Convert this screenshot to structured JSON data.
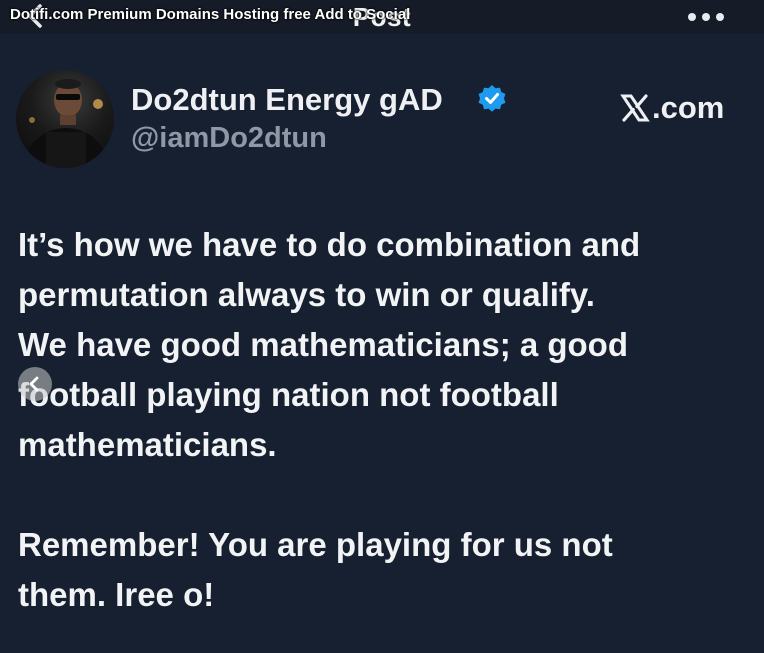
{
  "topbar": {
    "title": "Post",
    "overlay_text": "Dotifi.com Premium Domains Hosting free Add to Social",
    "back_icon": "chevron-left-icon",
    "more_icon": "more-horizontal-icon"
  },
  "tweet": {
    "display_name": "Do2dtun Energy gAD",
    "verified_icon": "verified-badge-icon",
    "verified_color": "#1d9bf0",
    "handle": "@iamDo2dtun",
    "platform": ".com",
    "platform_icon": "x-logo-icon",
    "paragraphs": [
      "It’s how we have to do combination and\npermutation always to win or qualify.\nWe have good mathematicians; a good\nfootball playing nation not football\nmathematicians.",
      "Remember! You are playing for us not\nthem. Iree o!"
    ]
  },
  "carousel": {
    "prev_icon": "chevron-left-icon"
  },
  "colors": {
    "background": "#151c27",
    "text": "#f1f3f5",
    "handle": "#8e98a6"
  }
}
